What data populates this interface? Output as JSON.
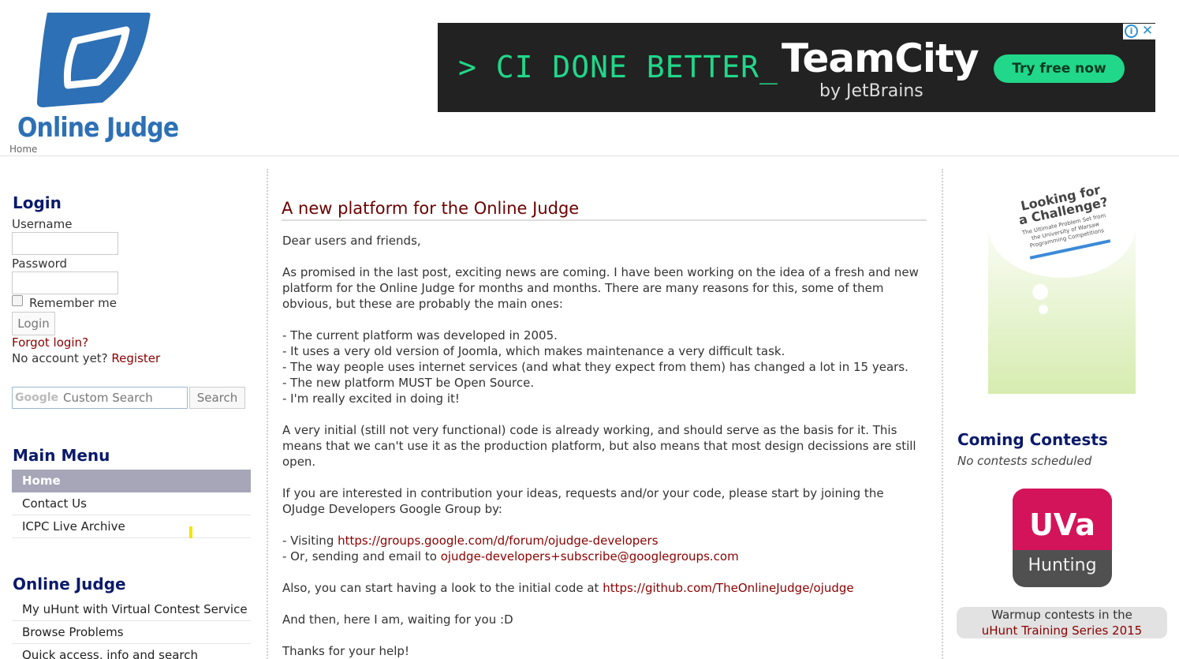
{
  "header": {
    "logo_text": "Online Judge",
    "breadcrumb": "Home",
    "logo_color": "#2d70b5"
  },
  "ad": {
    "tagline": "> CI DONE BETTER_",
    "brand": "TeamCity",
    "by": "by JetBrains",
    "cta": "Try free now",
    "info_icon": "i",
    "close_icon": "✕"
  },
  "login": {
    "title": "Login",
    "username_label": "Username",
    "username_value": "",
    "password_label": "Password",
    "password_value": "",
    "remember_label": "Remember me",
    "remember_checked": false,
    "login_button": "Login",
    "forgot": "Forgot login?",
    "no_account": "No account yet?",
    "register": "Register"
  },
  "search": {
    "logo": "Google",
    "placeholder": "Custom Search",
    "button": "Search"
  },
  "main_menu": {
    "title": "Main Menu",
    "items": [
      {
        "label": "Home",
        "active": true
      },
      {
        "label": "Contact Us",
        "active": false
      },
      {
        "label": "ICPC Live Archive",
        "active": false
      }
    ]
  },
  "online_judge_menu": {
    "title": "Online Judge",
    "items": [
      {
        "label": "My uHunt with Virtual Contest Service"
      },
      {
        "label": "Browse Problems"
      },
      {
        "label": "Quick access, info and search"
      }
    ]
  },
  "article": {
    "title": "A new platform for the Online Judge",
    "greeting": "Dear users and friends,",
    "intro": "As promised in the last post, exciting news are coming. I have been working on the idea of a fresh and new platform for the Online Judge for months and months. There are many reasons for this, some of them obvious, but these are probably the main ones:",
    "reasons": [
      "- The current platform was developed in 2005.",
      "- It uses a very old version of Joomla, which makes maintenance a very difficult task.",
      "- The way people uses internet services (and what they expect from them) has changed a lot in 15 years.",
      "- The new platform MUST be Open Source.",
      "- I'm really excited in doing it!"
    ],
    "para_code": "A very initial (still not very functional) code is already working, and should serve as the basis for it. This means that we can't use it as the production platform, but also means that most design decissions are still open.",
    "para_join": "If you are interested in contribution your ideas, requests and/or your code, please start by joining the OJudge Developers Google Group by:",
    "visiting_prefix": "- Visiting ",
    "visiting_link": "https://groups.google.com/d/forum/ojudge-developers",
    "email_prefix": "- Or, sending and email to ",
    "email_link": "ojudge-developers+subscribe@googlegroups.com",
    "code_prefix": "Also, you can start having a look to the initial code at ",
    "code_link": "https://github.com/TheOnlineJudge/ojudge",
    "waiting": "And then, here I am, waiting for you :D",
    "thanks": "Thanks for your help!"
  },
  "book": {
    "title_line1": "Looking for",
    "title_line2": "a Challenge?",
    "subtitle_line1": "The Ultimate Problem Set from",
    "subtitle_line2": "the University of Warsaw",
    "subtitle_line3": "Programming Competitions"
  },
  "contests": {
    "title": "Coming Contests",
    "status": "No contests scheduled"
  },
  "uva": {
    "word": "UVa",
    "sub": "Hunting",
    "brand_color": "#d4145a"
  },
  "warmup": {
    "line1": "Warmup contests in the",
    "link": "uHunt Training Series 2015"
  }
}
